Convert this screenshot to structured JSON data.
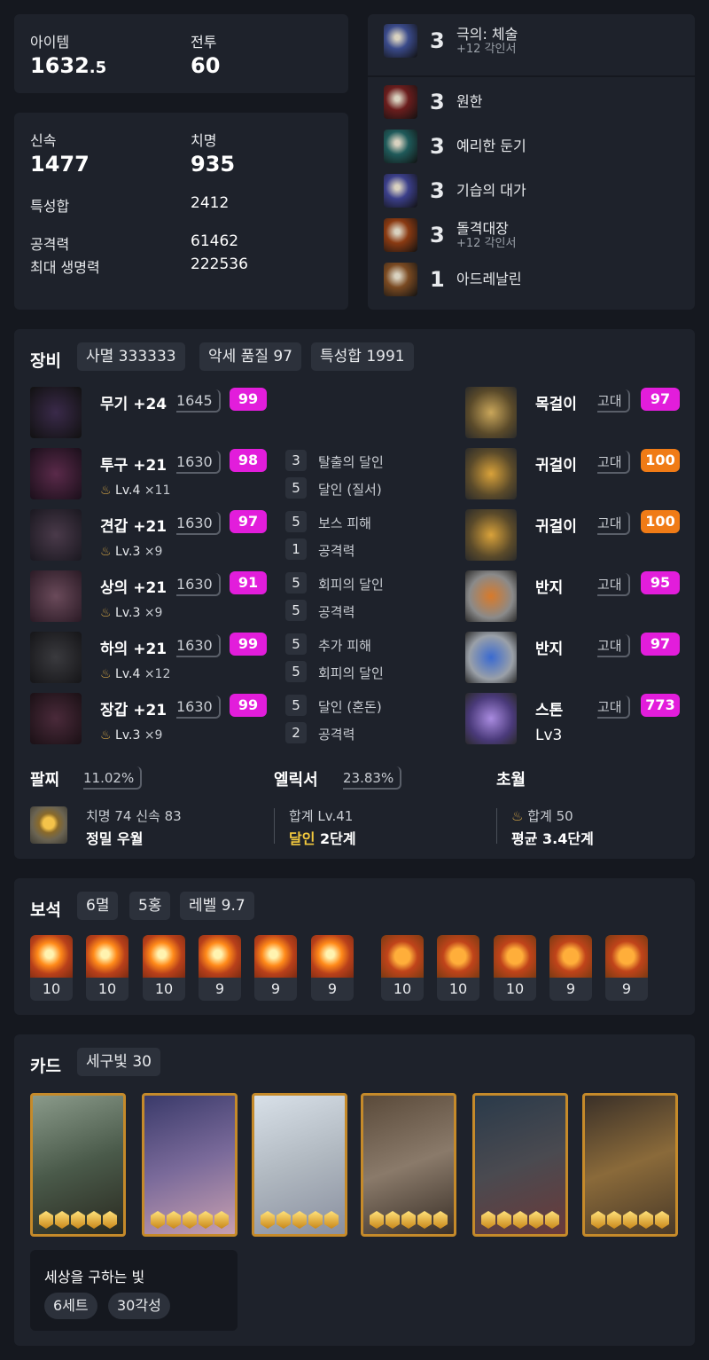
{
  "summary": {
    "item_label": "아이템",
    "item_level_main": "1632",
    "item_level_dec": ".5",
    "combat_label": "전투",
    "combat_level": "60"
  },
  "stats": {
    "swift_label": "신속",
    "swift_value": "1477",
    "crit_label": "치명",
    "crit_value": "935",
    "trait_sum_label": "특성합",
    "trait_sum_value": "2412",
    "attack_label": "공격력",
    "attack_value": "61462",
    "hp_label": "최대 생명력",
    "hp_value": "222536"
  },
  "engravings": [
    {
      "level": "3",
      "name": "극의: 체술",
      "sub": "+12 각인서",
      "icon": "martial-art-icon",
      "color": "#3a4a8a"
    },
    {
      "level": "3",
      "name": "원한",
      "sub": "",
      "icon": "grudge-icon",
      "color": "#6a1d1d"
    },
    {
      "level": "3",
      "name": "예리한 둔기",
      "sub": "",
      "icon": "keen-blunt-icon",
      "color": "#1f5a5a"
    },
    {
      "level": "3",
      "name": "기습의 대가",
      "sub": "",
      "icon": "master-ambush-icon",
      "color": "#3b3f8a"
    },
    {
      "level": "3",
      "name": "돌격대장",
      "sub": "+12 각인서",
      "icon": "raid-captain-icon",
      "color": "#8a3a12"
    },
    {
      "level": "1",
      "name": "아드레날린",
      "sub": "",
      "icon": "adrenaline-icon",
      "color": "#7a4a22"
    }
  ],
  "equipment": {
    "title": "장비",
    "chips": [
      "사멸 333333",
      "악세 품질 97",
      "특성합 1991"
    ],
    "armor": [
      {
        "name": "무기 +24",
        "ilvl": "1645",
        "quality": "99",
        "refine": "",
        "refine_count": "",
        "icon": "weapon-icon",
        "opts": []
      },
      {
        "name": "투구 +21",
        "ilvl": "1630",
        "quality": "98",
        "refine": "Lv.4",
        "refine_count": "×11",
        "icon": "helmet-icon",
        "opts": [
          {
            "n": "3",
            "t": "탈출의 달인"
          },
          {
            "n": "5",
            "t": "달인 (질서)"
          }
        ]
      },
      {
        "name": "견갑 +21",
        "ilvl": "1630",
        "quality": "97",
        "refine": "Lv.3",
        "refine_count": "×9",
        "icon": "shoulder-icon",
        "opts": [
          {
            "n": "5",
            "t": "보스 피해"
          },
          {
            "n": "1",
            "t": "공격력"
          }
        ]
      },
      {
        "name": "상의 +21",
        "ilvl": "1630",
        "quality": "91",
        "refine": "Lv.3",
        "refine_count": "×9",
        "icon": "chest-icon",
        "opts": [
          {
            "n": "5",
            "t": "회피의 달인"
          },
          {
            "n": "5",
            "t": "공격력"
          }
        ]
      },
      {
        "name": "하의 +21",
        "ilvl": "1630",
        "quality": "99",
        "refine": "Lv.4",
        "refine_count": "×12",
        "icon": "pants-icon",
        "opts": [
          {
            "n": "5",
            "t": "추가 피해"
          },
          {
            "n": "5",
            "t": "회피의 달인"
          }
        ]
      },
      {
        "name": "장갑 +21",
        "ilvl": "1630",
        "quality": "99",
        "refine": "Lv.3",
        "refine_count": "×9",
        "icon": "gloves-icon",
        "opts": [
          {
            "n": "5",
            "t": "달인 (혼돈)"
          },
          {
            "n": "2",
            "t": "공격력"
          }
        ]
      }
    ],
    "accessories": [
      {
        "name": "목걸이",
        "grade": "고대",
        "quality": "97",
        "color": "mag",
        "sub": "",
        "icon": "necklace-icon"
      },
      {
        "name": "귀걸이",
        "grade": "고대",
        "quality": "100",
        "color": "org",
        "sub": "",
        "icon": "earring-icon"
      },
      {
        "name": "귀걸이",
        "grade": "고대",
        "quality": "100",
        "color": "org",
        "sub": "",
        "icon": "earring-icon"
      },
      {
        "name": "반지",
        "grade": "고대",
        "quality": "95",
        "color": "mag",
        "sub": "",
        "icon": "ring-icon"
      },
      {
        "name": "반지",
        "grade": "고대",
        "quality": "97",
        "color": "mag",
        "sub": "",
        "icon": "ring-icon"
      },
      {
        "name": "스톤",
        "grade": "고대",
        "quality": "773",
        "color": "mag",
        "sub": "Lv3",
        "icon": "stone-icon"
      }
    ],
    "bracelet": {
      "title": "팔찌",
      "pct": "11.02%",
      "line1": "치명 74  신속 83",
      "line2": "정밀  우월"
    },
    "elixir": {
      "title": "엘릭서",
      "pct": "23.83%",
      "line1": "합계 Lv.41",
      "line2a": "달인",
      "line2b": " 2단계"
    },
    "transcend": {
      "title": "초월",
      "line1": "합계 50",
      "line2": "평균 3.4단계"
    }
  },
  "gems": {
    "title": "보석",
    "chips": [
      "6멸",
      "5홍",
      "레벨 9.7"
    ],
    "levels": [
      "10",
      "10",
      "10",
      "9",
      "9",
      "9",
      "10",
      "10",
      "10",
      "9",
      "9"
    ]
  },
  "cards": {
    "title": "카드",
    "chip": "세구빛 30",
    "set_name": "세상을 구하는 빛",
    "set_chips": [
      "6세트",
      "30각성"
    ],
    "awakening": [
      5,
      5,
      5,
      5,
      5,
      5
    ]
  }
}
